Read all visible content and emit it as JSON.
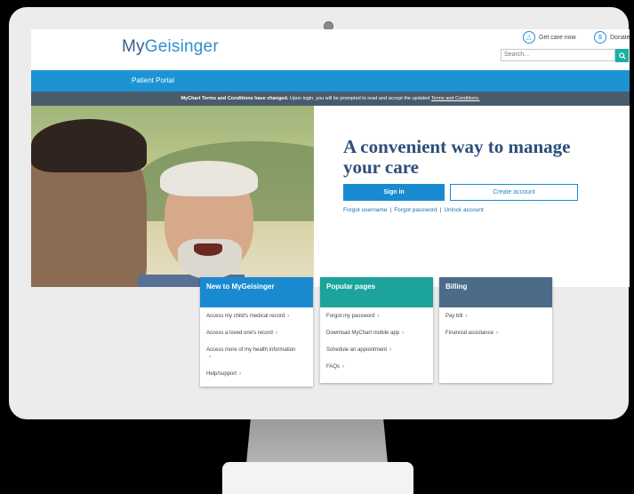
{
  "header": {
    "logo_my": "My",
    "logo_rest": "Geisinger",
    "get_care": "Get care now",
    "donate": "Donate",
    "search_placeholder": "Search...",
    "portal_title": "Patient Portal"
  },
  "notice": {
    "bold": "MyChart Terms and Conditions have changed.",
    "text": " Upon login, you will be prompted to read and accept the updated ",
    "link": "Terms and Conditions."
  },
  "hero": {
    "headline": "A convenient way to manage your care",
    "signin": "Sign in",
    "create": "Create account",
    "forgot_username": "Forgot username",
    "forgot_password": "Forgot password",
    "unlock": "Unlock account",
    "sep": "|"
  },
  "cards": [
    {
      "title": "New to MyGeisinger",
      "color": "#1a8ad0",
      "items": [
        "Access my child's medical record",
        "Access a loved one's record",
        "Access more of my health information",
        "Help/support"
      ]
    },
    {
      "title": "Popular pages",
      "color": "#1ba39c",
      "items": [
        "Forgot my password",
        "Download MyChart mobile app",
        "Schedule an appointment",
        "FAQs"
      ]
    },
    {
      "title": "Billing",
      "color": "#4b6b88",
      "items": [
        "Pay bill",
        "Financial assistance"
      ]
    }
  ],
  "chevron": "›"
}
